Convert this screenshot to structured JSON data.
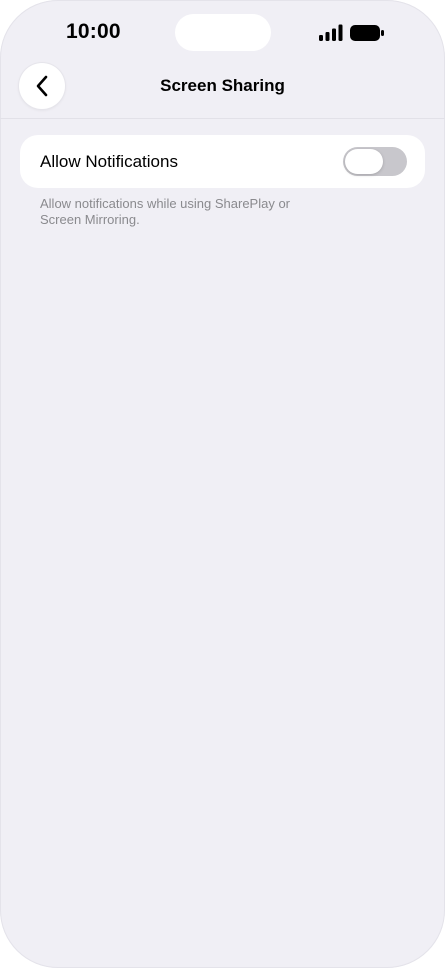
{
  "status_bar": {
    "time": "10:00",
    "icons": [
      "signal-icon",
      "battery-icon"
    ]
  },
  "nav": {
    "back_icon": "chevron-left-icon",
    "title": "Screen Sharing"
  },
  "settings": {
    "allow_notifications": {
      "label": "Allow Notifications",
      "enabled": false
    },
    "footer": "Allow notifications while using SharePlay or Screen Mirroring."
  },
  "colors": {
    "background": "#f0eff5",
    "card": "#ffffff",
    "toggle_off": "#c8c7cc",
    "footer_text": "#8a8a8e"
  }
}
